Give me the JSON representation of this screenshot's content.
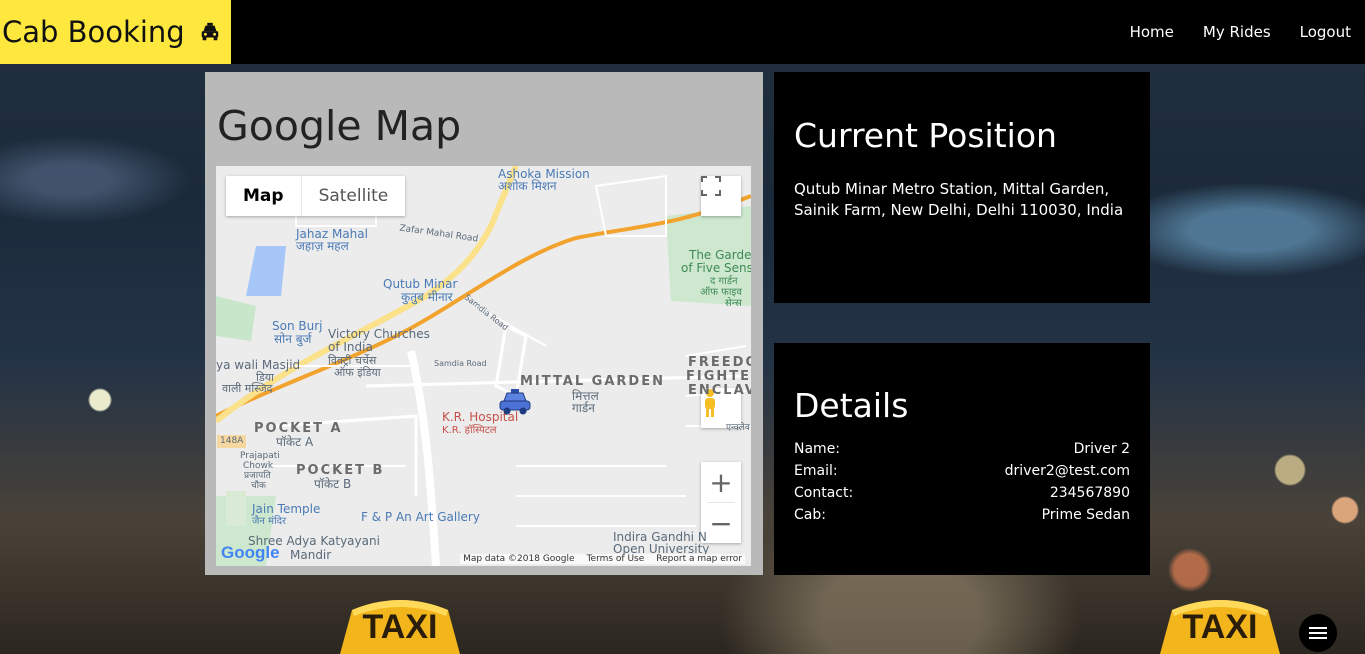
{
  "brand": {
    "title": "Cab Booking",
    "icon": "taxi-icon",
    "bg_color": "#ffe83d"
  },
  "nav": {
    "home": "Home",
    "my_rides": "My Rides",
    "logout": "Logout"
  },
  "map_panel": {
    "title": "Google Map",
    "map_type": {
      "map": "Map",
      "satellite": "Satellite",
      "selected": "Map"
    },
    "labels": {
      "ashoka": "Ashoka Mission",
      "ashoka_hi": "अशोक मिशन",
      "jahaz": "Jahaz Mahal",
      "jahaz_hi": "जहाज़ महल",
      "zafar": "Zafar Mahal Road",
      "qutub": "Qutub Minar",
      "qutub_hi": "कुतुब मीनार",
      "garden1": "The Garde",
      "garden2": "of Five Sens",
      "garden3": "द गार्डन",
      "garden4": "ऑफ फाइव",
      "garden5": "सेन्स",
      "sonburj": "Son Burj",
      "sonburj_hi": "सोन बुर्ज",
      "victory1": "Victory Churches",
      "victory2": "of India",
      "victory3": "विक्ट्री चर्चेस",
      "victory4": "ऑफ इंडिया",
      "samdia1": "Samdia Road",
      "samdia2": "Samdia Road",
      "masjid1": "ya wali Masjid",
      "masjid2": "डिया",
      "masjid3": "वाली मस्जिद",
      "mittal": "MITTAL GARDEN",
      "mittal_hi1": "मित्तल",
      "mittal_hi2": "गार्डन",
      "freedom1": "FREEDO",
      "freedom2": "FIGHTER",
      "freedom3": "ENCLAV",
      "freedom4": "एन्क्लेव",
      "kr": "K.R. Hospital",
      "kr_hi": "K.R. हॉस्पिटल",
      "pocketa": "POCKET A",
      "pocketa_hi": "पॉकेट A",
      "pocketb": "POCKET B",
      "pocketb_hi": "पॉकेट B",
      "prajapati1": "Prajapati",
      "prajapati2": "Chowk",
      "prajapati3": "प्रजापति",
      "prajapati4": "चौक",
      "route": "148A",
      "jain": "Jain Temple",
      "jain_hi": "जैन मंदिर",
      "fp": "F & P An Art Gallery",
      "indira1": "Indira Gandhi N",
      "indira2": "Open University",
      "katyayani1": "Shree Adya Katyayani",
      "katyayani2": "Mandir"
    },
    "google": "Google",
    "credits": {
      "data": "Map data ©2018 Google",
      "terms": "Terms of Use",
      "report": "Report a map error"
    }
  },
  "position_panel": {
    "title": "Current Position",
    "address": "Qutub Minar Metro Station, Mittal Garden, Sainik Farm, New Delhi, Delhi 110030, India"
  },
  "details_panel": {
    "title": "Details",
    "rows": [
      {
        "label": "Name:",
        "value": "Driver 2"
      },
      {
        "label": "Email:",
        "value": "driver2@test.com"
      },
      {
        "label": "Contact:",
        "value": "234567890"
      },
      {
        "label": "Cab:",
        "value": "Prime Sedan"
      }
    ]
  },
  "taxi_sign": {
    "text": "TAXI"
  },
  "menu_fab": {
    "icon": "hamburger-menu-icon"
  }
}
